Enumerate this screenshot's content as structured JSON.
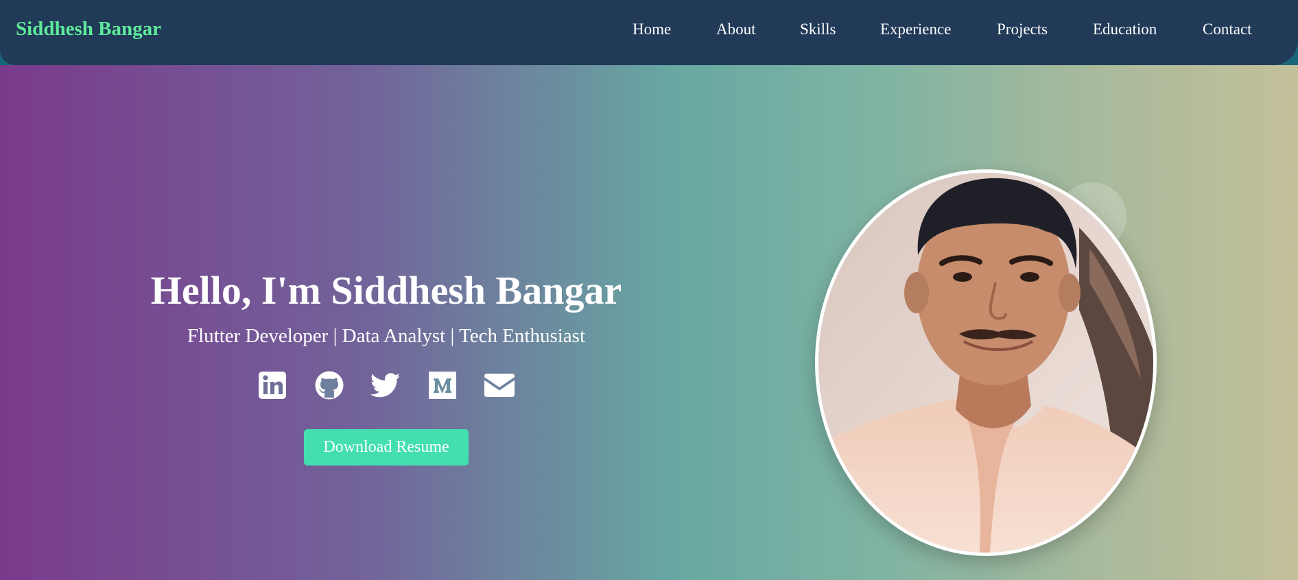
{
  "navbar": {
    "brand": "Siddhesh Bangar",
    "items": [
      {
        "label": "Home"
      },
      {
        "label": "About"
      },
      {
        "label": "Skills"
      },
      {
        "label": "Experience"
      },
      {
        "label": "Projects"
      },
      {
        "label": "Education"
      },
      {
        "label": "Contact"
      }
    ]
  },
  "hero": {
    "title": "Hello, I'm Siddhesh Bangar",
    "subtitle": "Flutter Developer | Data Analyst | Tech Enthusiast",
    "social_icons": [
      "linkedin-icon",
      "github-icon",
      "twitter-icon",
      "medium-icon",
      "email-icon"
    ],
    "resume_button": "Download Resume"
  },
  "colors": {
    "navbar_bg": "#213a58",
    "brand_text": "#5eea9a",
    "button_bg": "#43dfb0",
    "gradient": [
      "#7a3a8c",
      "#67a8a2",
      "#c3c09a"
    ]
  }
}
